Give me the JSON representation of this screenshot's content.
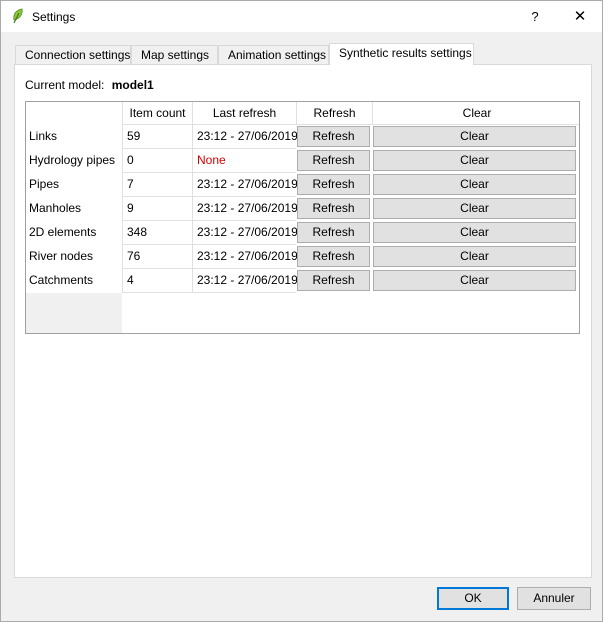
{
  "window": {
    "title": "Settings",
    "help_label": "?",
    "close_label": "✕"
  },
  "tabs": [
    {
      "label": "Connection settings"
    },
    {
      "label": "Map settings"
    },
    {
      "label": "Animation settings"
    },
    {
      "label": "Synthetic results settings",
      "active": true
    }
  ],
  "model": {
    "label": "Current model:",
    "value": "model1"
  },
  "table": {
    "headers": [
      "Item count",
      "Last refresh",
      "Refresh",
      "Clear"
    ],
    "rows": [
      {
        "name": "Links",
        "count": "59",
        "last_refresh": "23:12 - 27/06/2019",
        "refresh": "Refresh",
        "clear": "Clear"
      },
      {
        "name": "Hydrology pipes",
        "count": "0",
        "last_refresh": "None",
        "refresh": "Refresh",
        "clear": "Clear"
      },
      {
        "name": "Pipes",
        "count": "7",
        "last_refresh": "23:12 - 27/06/2019",
        "refresh": "Refresh",
        "clear": "Clear"
      },
      {
        "name": "Manholes",
        "count": "9",
        "last_refresh": "23:12 - 27/06/2019",
        "refresh": "Refresh",
        "clear": "Clear"
      },
      {
        "name": "2D elements",
        "count": "348",
        "last_refresh": "23:12 - 27/06/2019",
        "refresh": "Refresh",
        "clear": "Clear"
      },
      {
        "name": "River nodes",
        "count": "76",
        "last_refresh": "23:12 - 27/06/2019",
        "refresh": "Refresh",
        "clear": "Clear"
      },
      {
        "name": "Catchments",
        "count": "4",
        "last_refresh": "23:12 - 27/06/2019",
        "refresh": "Refresh",
        "clear": "Clear"
      }
    ]
  },
  "colors": {
    "none_text": "#d40000",
    "default_button_border": "#0078d7"
  },
  "buttons": {
    "ok": "OK",
    "cancel": "Annuler"
  }
}
